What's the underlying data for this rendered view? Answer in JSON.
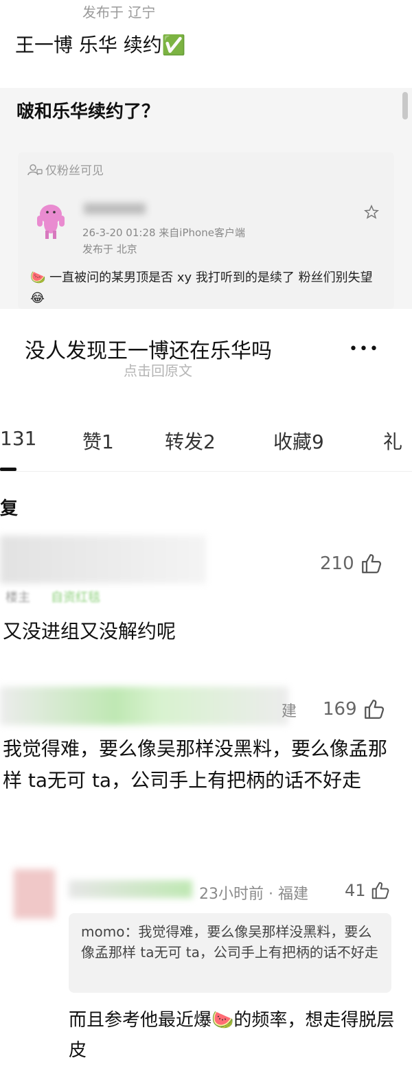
{
  "top_post": {
    "location": "发布于 辽宁",
    "text": "王一博 乐华 续约",
    "check_emoji": "✅"
  },
  "quoted_post": {
    "question": "啵和乐华续约了？",
    "visibility": "仅粉丝可见",
    "meta": "26-3-20 01:28  来自iPhone客户端",
    "location": "发布于 北京",
    "body": "一直被问的某男顶是否 xy 我打听到的是续了 粉丝们别失望",
    "emoji_a": "🍉",
    "emoji_b": "😂"
  },
  "original_title": "没人发现王一博还在乐华吗",
  "more_dots": "•••",
  "reply_link": "点击回原文",
  "tabs": [
    {
      "label": "131"
    },
    {
      "label": "赞1"
    },
    {
      "label": "转发2"
    },
    {
      "label": "收藏9"
    },
    {
      "label": "礼"
    }
  ],
  "section_label": "复",
  "comments": [
    {
      "likes": "210",
      "badge_left": "楼主",
      "badge_right": "自资红毯",
      "text": "又没进组又没解约呢"
    },
    {
      "likes": "169",
      "suffix": "建",
      "text": "我觉得难，要么像吴那样没黑料，要么像孟那样 ta无可 ta，公司手上有把柄的话不好走"
    },
    {
      "likes": "41",
      "time": "23小时前 · 福建",
      "quote": "momo：我觉得难，要么像吴那样没黑料，要么像孟那样 ta无可 ta，公司手上有把柄的话不好走",
      "text": "而且参考他最近爆",
      "emoji": "🍉",
      "text_tail": "的频率，想走得脱层皮"
    }
  ]
}
